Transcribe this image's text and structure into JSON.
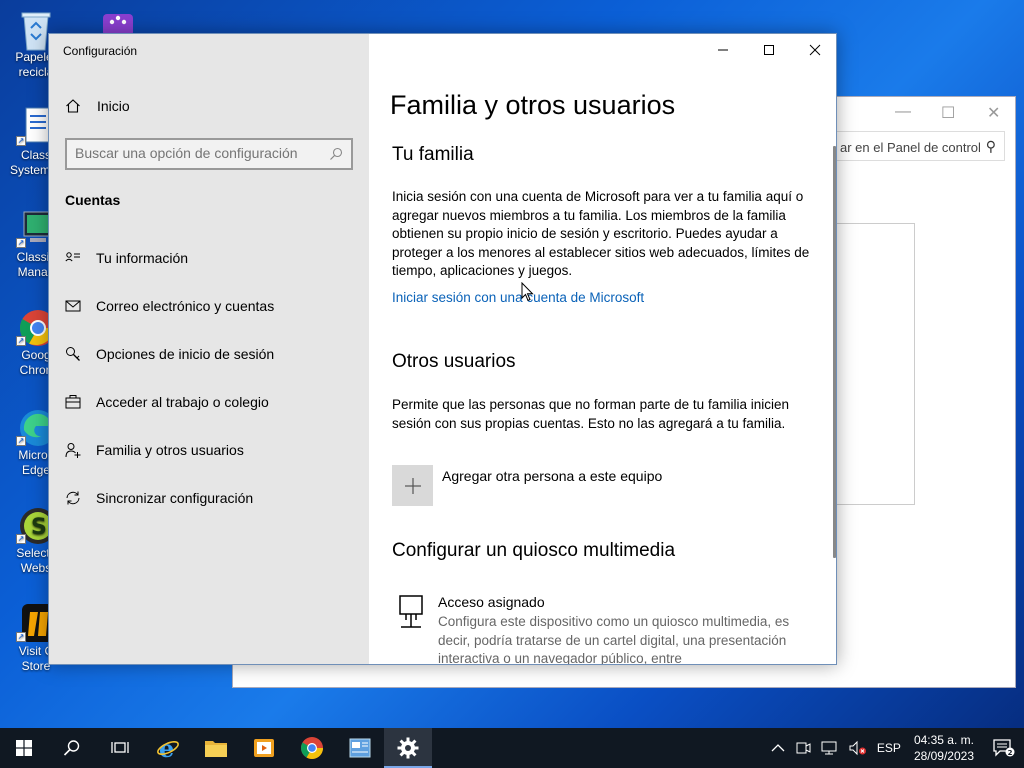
{
  "desktop": {
    "icons": [
      {
        "label_1": "Papeler",
        "label_2": "recicla",
        "icon": "recycle-bin-icon"
      },
      {
        "label_1": "Class",
        "label_2": "System C",
        "icon": "system-config-icon"
      },
      {
        "label_1": "Classic",
        "label_2": "Manag",
        "icon": "classic-manager-icon"
      },
      {
        "label_1": "Goog",
        "label_2": "Chron",
        "icon": "chrome-icon"
      },
      {
        "label_1": "Micros",
        "label_2": "Edge",
        "icon": "edge-icon"
      },
      {
        "label_1": "Selects",
        "label_2": "Webs",
        "icon": "selects-icon"
      },
      {
        "label_1": "Visit C",
        "label_2": "Store",
        "icon": "visit-store-icon"
      }
    ]
  },
  "background_window": {
    "search_placeholder": "ar en el Panel de control"
  },
  "settings": {
    "window_title": "Configuración",
    "home_label": "Inicio",
    "search_placeholder": "Buscar una opción de configuración",
    "section_title": "Cuentas",
    "nav_items": [
      {
        "label": "Tu información",
        "icon": "person-card-icon"
      },
      {
        "label": "Correo electrónico y cuentas",
        "icon": "mail-icon"
      },
      {
        "label": "Opciones de inicio de sesión",
        "icon": "key-icon"
      },
      {
        "label": "Acceder al trabajo o colegio",
        "icon": "briefcase-icon"
      },
      {
        "label": "Familia y otros usuarios",
        "icon": "person-add-icon"
      },
      {
        "label": "Sincronizar configuración",
        "icon": "sync-icon"
      }
    ],
    "content": {
      "title": "Familia y otros usuarios",
      "family_heading": "Tu familia",
      "family_text": "Inicia sesión con una cuenta de Microsoft para ver a tu familia aquí o agregar nuevos miembros a tu familia. Los miembros de la familia obtienen su propio inicio de sesión y escritorio. Puedes ayudar a proteger a los menores al establecer sitios web adecuados, límites de tiempo, aplicaciones y juegos.",
      "family_link": "Iniciar sesión con una cuenta de Microsoft",
      "others_heading": "Otros usuarios",
      "others_text": "Permite que las personas que no forman parte de tu familia inicien sesión con sus propias cuentas. Esto no las agregará a tu familia.",
      "add_person_label": "Agregar otra persona a este equipo",
      "kiosk_heading": "Configurar un quiosco multimedia",
      "kiosk_title": "Acceso asignado",
      "kiosk_text": "Configura este dispositivo como un quiosco multimedia, es decir, podría tratarse de un cartel digital, una presentación interactiva o un navegador público, entre"
    }
  },
  "taskbar": {
    "language": "ESP",
    "time": "04:35 a. m.",
    "date": "28/09/2023",
    "notification_count": "2"
  },
  "colors": {
    "link": "#0a62b8",
    "sidebar_bg": "#e6e6e6",
    "taskbar_bg": "#101822"
  }
}
